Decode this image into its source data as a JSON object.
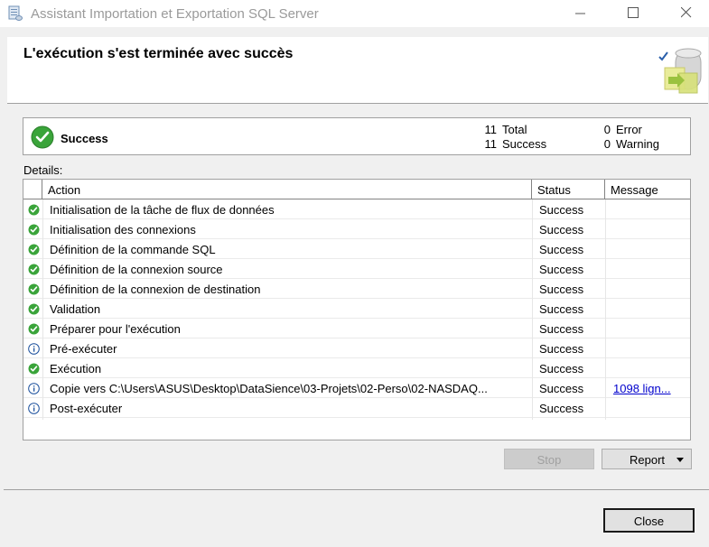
{
  "window": {
    "title": "Assistant Importation et Exportation SQL Server",
    "controls": [
      "minimize",
      "maximize",
      "close"
    ]
  },
  "header": {
    "title": "L'exécution s'est terminée avec succès"
  },
  "summary": {
    "status": "Success",
    "total_count": "11",
    "total_label": "Total",
    "success_count": "11",
    "success_label": "Success",
    "error_count": "0",
    "error_label": "Error",
    "warning_count": "0",
    "warning_label": "Warning"
  },
  "details": {
    "label": "Details:",
    "columns": {
      "action": "Action",
      "status": "Status",
      "message": "Message"
    },
    "rows": [
      {
        "icon": "success-check-icon",
        "action": "Initialisation de la tâche de flux de données",
        "status": "Success",
        "message": ""
      },
      {
        "icon": "success-check-icon",
        "action": "Initialisation des connexions",
        "status": "Success",
        "message": ""
      },
      {
        "icon": "success-check-icon",
        "action": "Définition de la commande SQL",
        "status": "Success",
        "message": ""
      },
      {
        "icon": "success-check-icon",
        "action": "Définition de la connexion source",
        "status": "Success",
        "message": ""
      },
      {
        "icon": "success-check-icon",
        "action": "Définition de la connexion de destination",
        "status": "Success",
        "message": ""
      },
      {
        "icon": "success-check-icon",
        "action": "Validation",
        "status": "Success",
        "message": ""
      },
      {
        "icon": "success-check-icon",
        "action": "Préparer pour l'exécution",
        "status": "Success",
        "message": ""
      },
      {
        "icon": "info-icon",
        "action": "Pré-exécuter",
        "status": "Success",
        "message": ""
      },
      {
        "icon": "success-check-icon",
        "action": "Exécution",
        "status": "Success",
        "message": ""
      },
      {
        "icon": "info-icon",
        "action": "Copie vers C:\\Users\\ASUS\\Desktop\\DataSience\\03-Projets\\02-Perso\\02-NASDAQ...",
        "status": "Success",
        "message": "1098 lign..."
      },
      {
        "icon": "info-icon",
        "action": "Post-exécuter",
        "status": "Success",
        "message": ""
      }
    ]
  },
  "buttons": {
    "stop": "Stop",
    "report": "Report",
    "close": "Close"
  },
  "colors": {
    "success_green": "#3aa43a",
    "info_blue": "#1a4f9c",
    "link": "#0000cc"
  }
}
